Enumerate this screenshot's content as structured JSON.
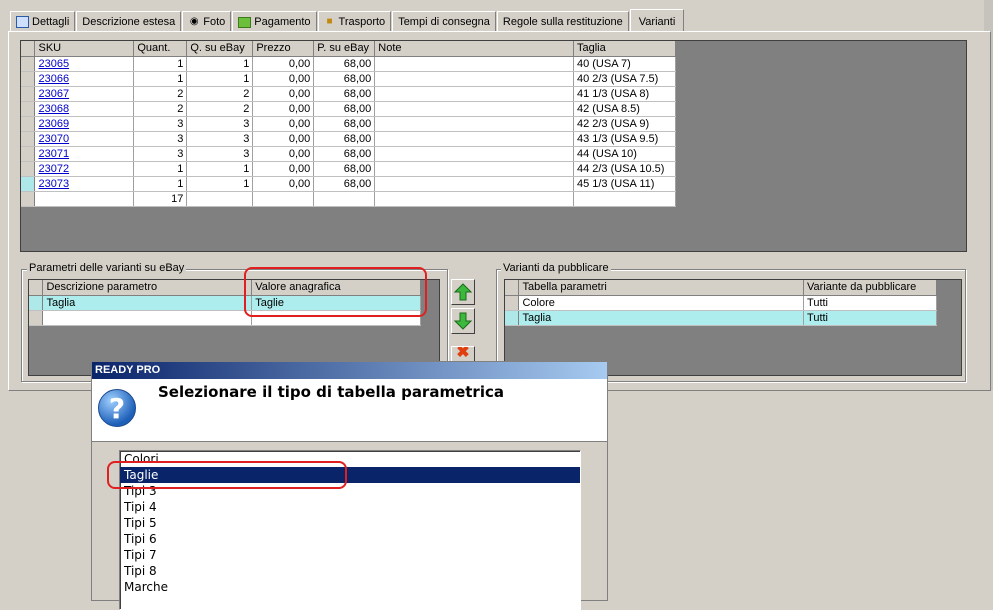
{
  "tabs": [
    {
      "label": "Dettagli",
      "icon": "details-icon"
    },
    {
      "label": "Descrizione estesa",
      "icon": ""
    },
    {
      "label": "Foto",
      "icon": "camera-icon"
    },
    {
      "label": "Pagamento",
      "icon": "payment-icon"
    },
    {
      "label": "Trasporto",
      "icon": "truck-icon"
    },
    {
      "label": "Tempi di consegna",
      "icon": ""
    },
    {
      "label": "Regole sulla restituzione",
      "icon": ""
    },
    {
      "label": "Varianti",
      "icon": "",
      "active": true
    }
  ],
  "variants_table": {
    "headers": [
      "SKU",
      "Quant.",
      "Q. su eBay",
      "Prezzo",
      "P. su eBay",
      "Note",
      "Taglia"
    ],
    "rows": [
      {
        "sku": "23065",
        "quant": "1",
        "q_ebay": "1",
        "prezzo": "0,00",
        "p_ebay": "68,00",
        "note": "",
        "taglia": "40 (USA 7)"
      },
      {
        "sku": "23066",
        "quant": "1",
        "q_ebay": "1",
        "prezzo": "0,00",
        "p_ebay": "68,00",
        "note": "",
        "taglia": "40 2/3 (USA 7.5)"
      },
      {
        "sku": "23067",
        "quant": "2",
        "q_ebay": "2",
        "prezzo": "0,00",
        "p_ebay": "68,00",
        "note": "",
        "taglia": "41 1/3 (USA 8)"
      },
      {
        "sku": "23068",
        "quant": "2",
        "q_ebay": "2",
        "prezzo": "0,00",
        "p_ebay": "68,00",
        "note": "",
        "taglia": "42 (USA 8.5)"
      },
      {
        "sku": "23069",
        "quant": "3",
        "q_ebay": "3",
        "prezzo": "0,00",
        "p_ebay": "68,00",
        "note": "",
        "taglia": "42 2/3 (USA 9)"
      },
      {
        "sku": "23070",
        "quant": "3",
        "q_ebay": "3",
        "prezzo": "0,00",
        "p_ebay": "68,00",
        "note": "",
        "taglia": "43 1/3 (USA 9.5)"
      },
      {
        "sku": "23071",
        "quant": "3",
        "q_ebay": "3",
        "prezzo": "0,00",
        "p_ebay": "68,00",
        "note": "",
        "taglia": "44 (USA 10)"
      },
      {
        "sku": "23072",
        "quant": "1",
        "q_ebay": "1",
        "prezzo": "0,00",
        "p_ebay": "68,00",
        "note": "",
        "taglia": "44 2/3 (USA 10.5)"
      },
      {
        "sku": "23073",
        "quant": "1",
        "q_ebay": "1",
        "prezzo": "0,00",
        "p_ebay": "68,00",
        "note": "",
        "taglia": "45 1/3 (USA 11)"
      }
    ],
    "total_quant": "17"
  },
  "params_group": {
    "title": "Parametri delle varianti su eBay",
    "headers": [
      "Descrizione parametro",
      "Valore anagrafica"
    ],
    "rows": [
      {
        "descr": "Taglia",
        "valore": "Taglie"
      }
    ]
  },
  "publish_group": {
    "title": "Varianti da pubblicare",
    "headers": [
      "Tabella parametri",
      "Variante da pubblicare"
    ],
    "rows": [
      {
        "tabella": "Colore",
        "variante": "Tutti"
      },
      {
        "tabella": "Taglia",
        "variante": "Tutti"
      }
    ]
  },
  "dialog": {
    "title": "READY PRO",
    "question": "Selezionare il tipo di tabella parametrica",
    "items": [
      "Colori",
      "Taglie",
      "Tipi 3",
      "Tipi 4",
      "Tipi 5",
      "Tipi 6",
      "Tipi 7",
      "Tipi 8",
      "Marche"
    ],
    "selected": "Taglie"
  },
  "colors": {
    "highlight": "#aeeded",
    "selection": "#0a246a",
    "annotation": "#e02020"
  }
}
